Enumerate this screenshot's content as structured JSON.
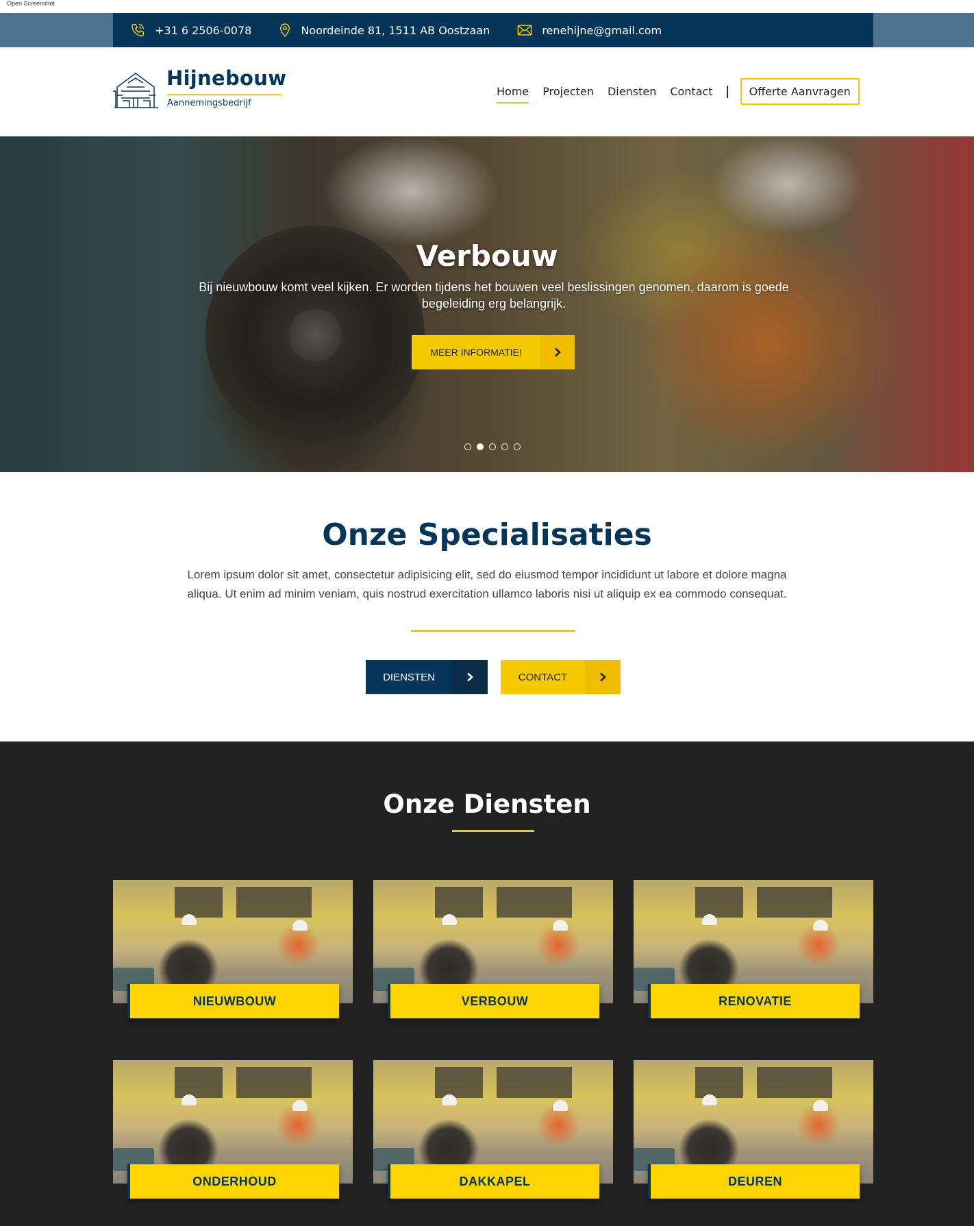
{
  "caption": "Open Screenshot",
  "topbar": {
    "phone": "+31 6 2506-0078",
    "address": "Noordeinde 81, 1511 AB Oostzaan",
    "email": "renehijne@gmail.com",
    "icons": [
      "phone-icon",
      "map-pin-icon",
      "mail-icon"
    ]
  },
  "header": {
    "brand": "Hijnebouw",
    "tagline": "Aannemingsbedrijf",
    "nav": [
      "Home",
      "Projecten",
      "Diensten",
      "Contact"
    ],
    "active_nav": "Home",
    "cta": "Offerte Aanvragen"
  },
  "hero": {
    "title": "Verbouw",
    "text": "Bij nieuwbouw komt veel kijken. Er worden tijdens het bouwen veel beslissingen genomen, daarom is goede begeleiding erg belangrijk.",
    "button": "MEER INFORMATIE!",
    "slides": 5,
    "active_slide": 2
  },
  "specialisaties": {
    "title": "Onze Specialisaties",
    "text": "Lorem ipsum dolor sit amet, consectetur adipisicing elit, sed do eiusmod tempor incididunt ut labore et dolore magna aliqua. Ut enim ad minim veniam, quis nostrud exercitation ullamco laboris nisi ut aliquip ex ea commodo consequat.",
    "button_primary": "DIENSTEN",
    "button_secondary": "CONTACT"
  },
  "diensten": {
    "title": "Onze Diensten",
    "cards": [
      "NIEUWBOUW",
      "VERBOUW",
      "RENOVATIE",
      "ONDERHOUD",
      "DAKKAPEL",
      "DEUREN"
    ]
  },
  "colors": {
    "navy": "#05365a",
    "yellow": "#f5c900",
    "dark": "#222222",
    "topbar_outer": "#4e7290"
  }
}
